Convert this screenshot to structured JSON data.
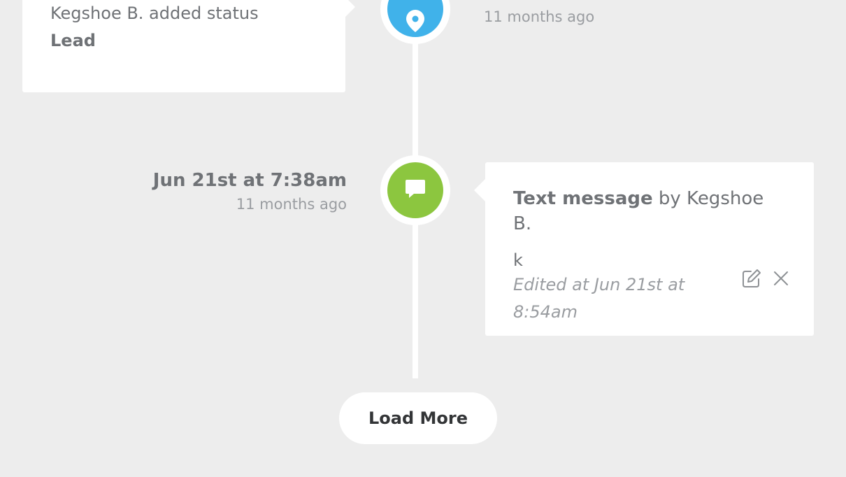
{
  "events": [
    {
      "type": "status",
      "icon": "location-pin-icon",
      "color": "#40b2ea",
      "relative_time": "11 months ago",
      "line1": "Kegshoe B. added status",
      "value": "Lead"
    },
    {
      "type": "text-message",
      "icon": "chat-bubble-icon",
      "color": "#8cc63f",
      "date": "Jun 21st at 7:38am",
      "relative_time": "11 months ago",
      "title_bold": "Text message",
      "title_rest": " by Kegshoe B.",
      "body": "k",
      "edited": "Edited at Jun 21st at 8:54am"
    }
  ],
  "load_more_label": "Load More"
}
